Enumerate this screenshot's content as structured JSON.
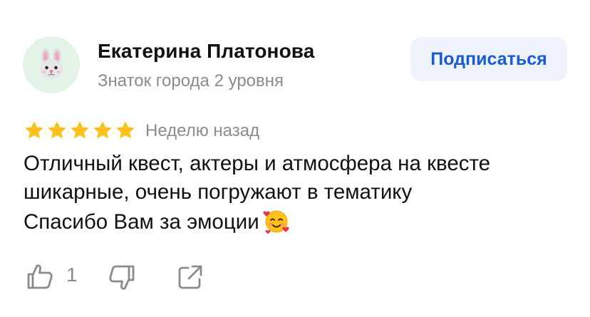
{
  "author": {
    "name": "Екатерина Платонова",
    "level": "Знаток города 2 уровня",
    "avatar_icon": "rabbit-face-icon",
    "avatar_bg": "#e3f3e6"
  },
  "subscribe": {
    "label": "Подписаться",
    "color": "#1a5ad6",
    "bg": "#eef3fb"
  },
  "rating": {
    "value": 5,
    "max": 5,
    "star_color": "#fcc21b",
    "icon": "star-icon"
  },
  "review": {
    "date": "Неделю назад",
    "lines": [
      "Отличный квест, актеры и атмосфера на квесте",
      "шикарные, очень погружают в тематику",
      "Спасибо Вам за эмоции"
    ],
    "emoji": "smiling-face-with-hearts-icon"
  },
  "actions": {
    "like_icon": "thumbs-up-icon",
    "like_count": "1",
    "dislike_icon": "thumbs-down-icon",
    "share_icon": "share-icon",
    "icon_color": "#8a8a8f"
  }
}
